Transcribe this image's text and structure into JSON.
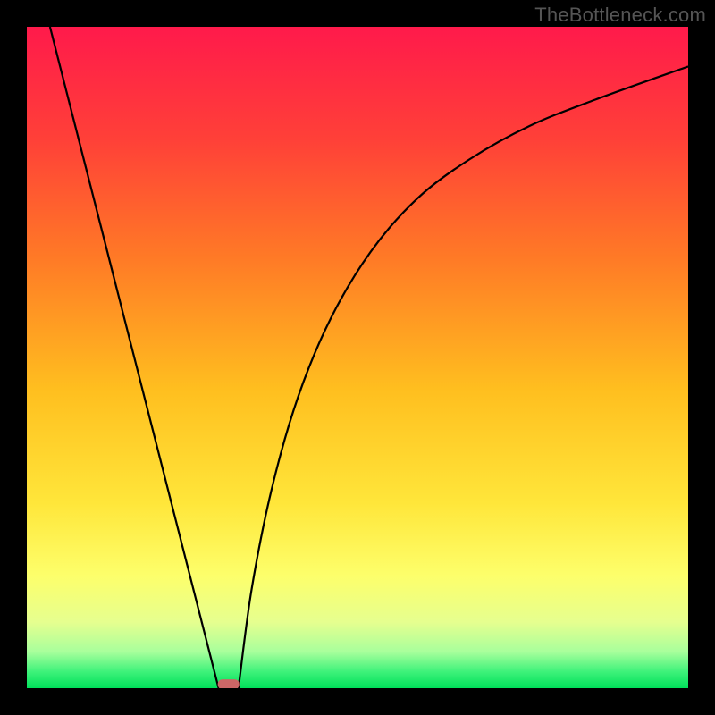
{
  "watermark": "TheBottleneck.com",
  "chart_data": {
    "type": "line",
    "title": "",
    "xlabel": "",
    "ylabel": "",
    "x_range": [
      0,
      1
    ],
    "y_range": [
      0,
      1
    ],
    "background_gradient_stops": [
      {
        "offset": 0.0,
        "color": "#ff1a4b"
      },
      {
        "offset": 0.17,
        "color": "#ff4038"
      },
      {
        "offset": 0.35,
        "color": "#ff7a26"
      },
      {
        "offset": 0.55,
        "color": "#ffbf1f"
      },
      {
        "offset": 0.72,
        "color": "#ffe63a"
      },
      {
        "offset": 0.83,
        "color": "#fdff6b"
      },
      {
        "offset": 0.9,
        "color": "#e6ff8f"
      },
      {
        "offset": 0.945,
        "color": "#a8ff9c"
      },
      {
        "offset": 0.975,
        "color": "#3ef27a"
      },
      {
        "offset": 1.0,
        "color": "#00e05a"
      }
    ],
    "minimum_marker": {
      "x": 0.305,
      "y": 0.994,
      "color": "#cc6666"
    },
    "series": [
      {
        "name": "left-branch",
        "description": "Steep straight line descending from top-left toward the minimum.",
        "points": [
          {
            "x": 0.035,
            "y": 1.0
          },
          {
            "x": 0.29,
            "y": 0.0
          }
        ]
      },
      {
        "name": "right-branch",
        "description": "Curve rising from the minimum, concave, flattening toward the right edge.",
        "points": [
          {
            "x": 0.32,
            "y": 0.0
          },
          {
            "x": 0.34,
            "y": 0.15
          },
          {
            "x": 0.37,
            "y": 0.3
          },
          {
            "x": 0.41,
            "y": 0.44
          },
          {
            "x": 0.46,
            "y": 0.56
          },
          {
            "x": 0.52,
            "y": 0.66
          },
          {
            "x": 0.59,
            "y": 0.74
          },
          {
            "x": 0.67,
            "y": 0.8
          },
          {
            "x": 0.76,
            "y": 0.85
          },
          {
            "x": 0.86,
            "y": 0.89
          },
          {
            "x": 1.0,
            "y": 0.94
          }
        ]
      }
    ]
  }
}
